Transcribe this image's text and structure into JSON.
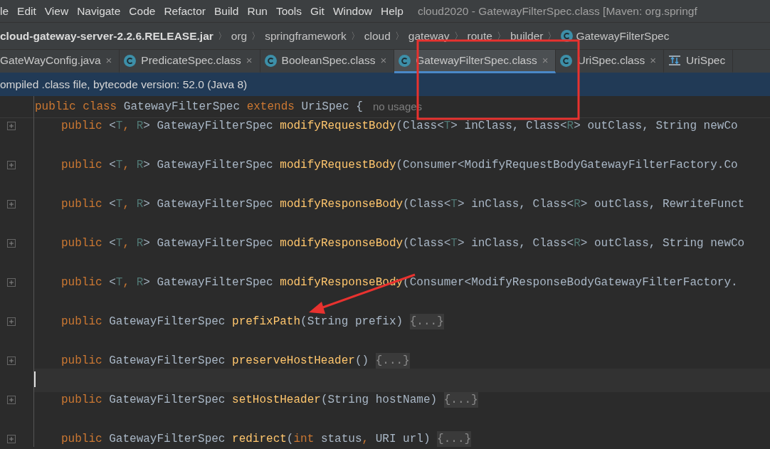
{
  "menu": [
    "le",
    "Edit",
    "View",
    "Navigate",
    "Code",
    "Refactor",
    "Build",
    "Run",
    "Tools",
    "Git",
    "Window",
    "Help"
  ],
  "window": {
    "title": "cloud2020 - GatewayFilterSpec.class [Maven: org.springf"
  },
  "breadcrumb": [
    {
      "label": "cloud-gateway-server-2.2.6.RELEASE.jar",
      "kind": "jar"
    },
    {
      "separator": "〉",
      "label": "org",
      "kind": "package"
    },
    {
      "separator": "〉",
      "label": "springframework",
      "kind": "package"
    },
    {
      "separator": "〉",
      "label": "cloud",
      "kind": "package"
    },
    {
      "separator": "〉",
      "label": "gateway",
      "kind": "package"
    },
    {
      "separator": "〉",
      "label": "route",
      "kind": "package"
    },
    {
      "separator": "〉",
      "label": "builder",
      "kind": "package"
    },
    {
      "separator": "〉",
      "label": "GatewayFilterSpec",
      "kind": "class"
    }
  ],
  "tabs": [
    {
      "label": "GateWayConfig.java",
      "selected": false,
      "close": "×"
    },
    {
      "label": "PredicateSpec.class",
      "kind": "class",
      "selected": false,
      "close": "×"
    },
    {
      "label": "BooleanSpec.class",
      "kind": "class",
      "selected": false,
      "close": "×"
    },
    {
      "label": "GatewayFilterSpec.class",
      "kind": "class",
      "selected": true,
      "close": "×"
    },
    {
      "label": "UriSpec.class",
      "kind": "class",
      "selected": false,
      "close": "×"
    },
    {
      "label": "UriSpec",
      "kind": "structure",
      "selected": false
    }
  ],
  "banner": "ompiled .class file, bytecode version: 52.0 (Java 8)",
  "editor": {
    "header": {
      "tokens": [
        {
          "t": "public class ",
          "kind": "kw"
        },
        {
          "t": "GatewayFilterSpec ",
          "kind": "plain"
        },
        {
          "t": "extends ",
          "kind": "kw"
        },
        {
          "t": "UriSpec {",
          "kind": "plain"
        }
      ],
      "hint": "no usages"
    },
    "rows": [
      {
        "kind": "code",
        "tokens": [
          {
            "t": "public ",
            "kind": "kw"
          },
          {
            "t": "<",
            "kind": "plain"
          },
          {
            "t": "T",
            "kind": "gen"
          },
          {
            "t": ", ",
            "kind": "kw"
          },
          {
            "t": "R",
            "kind": "gen"
          },
          {
            "t": "> GatewayFilterSpec ",
            "kind": "plain"
          },
          {
            "t": "modifyRequestBody",
            "kind": "method"
          },
          {
            "t": "(Class<",
            "kind": "plain"
          },
          {
            "t": "T",
            "kind": "gen"
          },
          {
            "t": "> inClass, Class<",
            "kind": "plain"
          },
          {
            "t": "R",
            "kind": "gen"
          },
          {
            "t": "> outClass, String newCo",
            "kind": "plain"
          }
        ]
      },
      {
        "kind": "code",
        "tokens": [
          {
            "t": "public ",
            "kind": "kw"
          },
          {
            "t": "<",
            "kind": "plain"
          },
          {
            "t": "T",
            "kind": "gen"
          },
          {
            "t": ", ",
            "kind": "kw"
          },
          {
            "t": "R",
            "kind": "gen"
          },
          {
            "t": "> GatewayFilterSpec ",
            "kind": "plain"
          },
          {
            "t": "modifyRequestBody",
            "kind": "method"
          },
          {
            "t": "(Consumer<ModifyRequestBodyGatewayFilterFactory.Co",
            "kind": "plain"
          }
        ]
      },
      {
        "kind": "code",
        "tokens": [
          {
            "t": "public ",
            "kind": "kw"
          },
          {
            "t": "<",
            "kind": "plain"
          },
          {
            "t": "T",
            "kind": "gen"
          },
          {
            "t": ", ",
            "kind": "kw"
          },
          {
            "t": "R",
            "kind": "gen"
          },
          {
            "t": "> GatewayFilterSpec ",
            "kind": "plain"
          },
          {
            "t": "modifyResponseBody",
            "kind": "method"
          },
          {
            "t": "(Class<",
            "kind": "plain"
          },
          {
            "t": "T",
            "kind": "gen"
          },
          {
            "t": "> inClass, Class<",
            "kind": "plain"
          },
          {
            "t": "R",
            "kind": "gen"
          },
          {
            "t": "> outClass, RewriteFunct",
            "kind": "plain"
          }
        ]
      },
      {
        "kind": "code",
        "tokens": [
          {
            "t": "public ",
            "kind": "kw"
          },
          {
            "t": "<",
            "kind": "plain"
          },
          {
            "t": "T",
            "kind": "gen"
          },
          {
            "t": ", ",
            "kind": "kw"
          },
          {
            "t": "R",
            "kind": "gen"
          },
          {
            "t": "> GatewayFilterSpec ",
            "kind": "plain"
          },
          {
            "t": "modifyResponseBody",
            "kind": "method"
          },
          {
            "t": "(Class<",
            "kind": "plain"
          },
          {
            "t": "T",
            "kind": "gen"
          },
          {
            "t": "> inClass, Class<",
            "kind": "plain"
          },
          {
            "t": "R",
            "kind": "gen"
          },
          {
            "t": "> outClass, String newCo",
            "kind": "plain"
          }
        ]
      },
      {
        "kind": "code",
        "tokens": [
          {
            "t": "public ",
            "kind": "kw"
          },
          {
            "t": "<",
            "kind": "plain"
          },
          {
            "t": "T",
            "kind": "gen"
          },
          {
            "t": ", ",
            "kind": "kw"
          },
          {
            "t": "R",
            "kind": "gen"
          },
          {
            "t": "> GatewayFilterSpec ",
            "kind": "plain"
          },
          {
            "t": "modifyResponseBody",
            "kind": "method"
          },
          {
            "t": "(Consumer<ModifyResponseBodyGatewayFilterFactory.",
            "kind": "plain"
          }
        ]
      },
      {
        "kind": "code",
        "tokens": [
          {
            "t": "public ",
            "kind": "kw"
          },
          {
            "t": "GatewayFilterSpec ",
            "kind": "plain"
          },
          {
            "t": "prefixPath",
            "kind": "method"
          },
          {
            "t": "(String prefix) ",
            "kind": "plain"
          },
          {
            "t": "{...}",
            "kind": "fold"
          }
        ]
      },
      {
        "kind": "code",
        "tokens": [
          {
            "t": "public ",
            "kind": "kw"
          },
          {
            "t": "GatewayFilterSpec ",
            "kind": "plain"
          },
          {
            "t": "preserveHostHeader",
            "kind": "method"
          },
          {
            "t": "() ",
            "kind": "plain"
          },
          {
            "t": "{...}",
            "kind": "fold"
          }
        ]
      },
      {
        "kind": "current_line"
      },
      {
        "kind": "code",
        "tokens": [
          {
            "t": "public ",
            "kind": "kw"
          },
          {
            "t": "GatewayFilterSpec ",
            "kind": "plain"
          },
          {
            "t": "setHostHeader",
            "kind": "method"
          },
          {
            "t": "(String hostName) ",
            "kind": "plain"
          },
          {
            "t": "{...}",
            "kind": "fold"
          }
        ]
      },
      {
        "kind": "code",
        "tokens": [
          {
            "t": "public ",
            "kind": "kw"
          },
          {
            "t": "GatewayFilterSpec ",
            "kind": "plain"
          },
          {
            "t": "redirect",
            "kind": "method"
          },
          {
            "t": "(",
            "kind": "plain"
          },
          {
            "t": "int ",
            "kind": "kw"
          },
          {
            "t": "status",
            "kind": "plain"
          },
          {
            "t": ", ",
            "kind": "kw"
          },
          {
            "t": "URI url) ",
            "kind": "plain"
          },
          {
            "t": "{...}",
            "kind": "fold"
          }
        ]
      }
    ]
  },
  "annotations": {
    "box": true,
    "arrow": true
  }
}
